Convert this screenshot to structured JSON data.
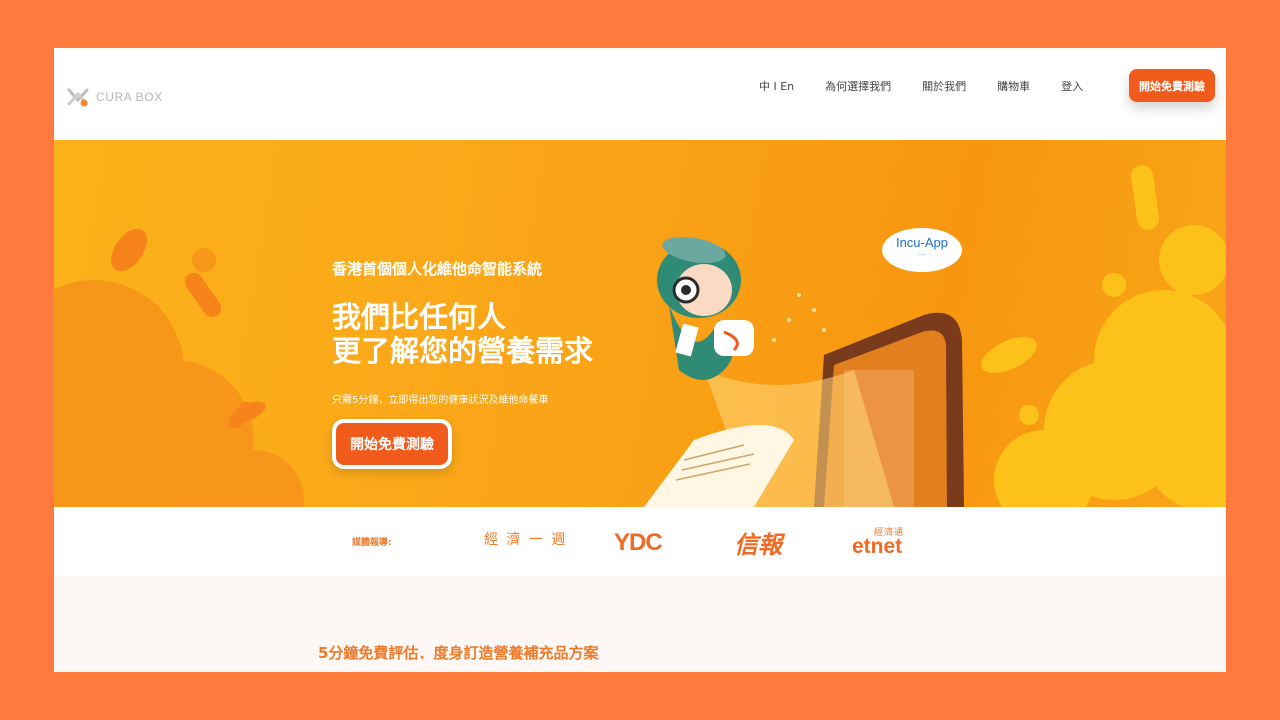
{
  "brand": {
    "name": "CURA BOX",
    "accent": "#f05a1b",
    "hero_color": "#fba91a"
  },
  "nav": {
    "items": [
      {
        "label": "中 I En"
      },
      {
        "label": "為何選擇我們"
      },
      {
        "label": "關於我們"
      },
      {
        "label": "購物車"
      },
      {
        "label": "登入"
      }
    ],
    "cta_label": "開始免費測驗"
  },
  "hero": {
    "subtitle": "香港首個個人化維他命智能系統",
    "title_line1": "我們比任何人",
    "title_line2": "更了解您的營養需求",
    "note": "只需5分鐘，立即得出您的健康狀況及維他命餐車",
    "cta_label": "開始免費測驗",
    "badge": {
      "name": "Incu-App",
      "tagline": "...."
    }
  },
  "media": {
    "label": "媒體報導:",
    "outlets": [
      "經 濟 一 週",
      "YDC",
      "信報",
      "經濟通",
      "etnet"
    ]
  },
  "section": {
    "heading": "5分鐘免費評估．度身訂造營養補充品方案"
  }
}
